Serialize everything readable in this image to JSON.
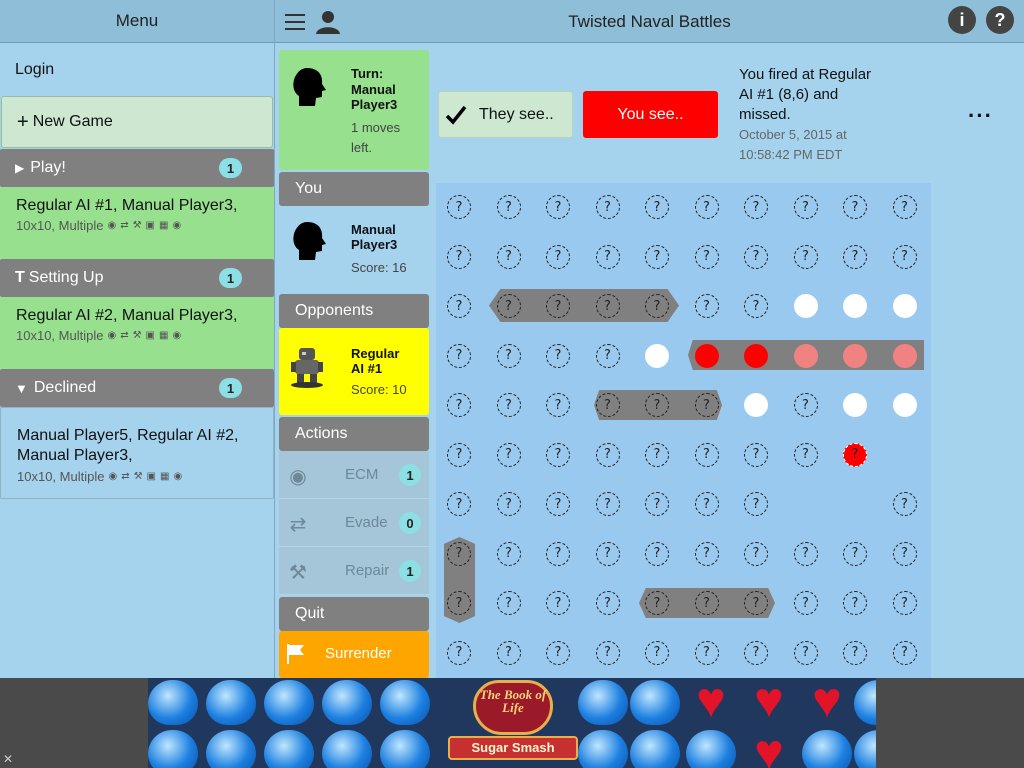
{
  "menu": {
    "title": "Menu",
    "login": "Login",
    "new_game": "New Game",
    "sections": {
      "play": {
        "label": "Play!",
        "count": "1"
      },
      "setting_up": {
        "label": "Setting Up",
        "count": "1"
      },
      "declined": {
        "label": "Declined",
        "count": "1"
      }
    },
    "games": {
      "play": {
        "title": "Regular AI #1, Manual Player3,",
        "sub": "10x10, Multiple"
      },
      "setting_up": {
        "title": "Regular AI #2, Manual Player3,",
        "sub": "10x10, Multiple"
      },
      "declined": {
        "title": "Manual Player5, Regular AI #2, Manual Player3,",
        "sub": "10x10, Multiple"
      }
    }
  },
  "header": {
    "title": "Twisted Naval Battles"
  },
  "turn": {
    "label": "Turn:",
    "player": "Manual Player3",
    "moves": "1 moves left."
  },
  "you": {
    "header": "You",
    "name": "Manual Player3",
    "score": "Score: 16"
  },
  "opponents": {
    "header": "Opponents",
    "name": "Regular AI #1",
    "score": "Score: 10"
  },
  "actions": {
    "header": "Actions",
    "items": [
      {
        "label": "ECM",
        "count": "1",
        "icon": "eye-slash-icon"
      },
      {
        "label": "Evade",
        "count": "0",
        "icon": "shuffle-icon"
      },
      {
        "label": "Repair",
        "count": "1",
        "icon": "wrench-icon"
      }
    ]
  },
  "quit": {
    "header": "Quit",
    "surrender": "Surrender"
  },
  "view": {
    "they_see": "They see..",
    "you_see": "You see.."
  },
  "message": {
    "text": "You fired at Regular AI #1 (8,6) and missed.",
    "date": "October 5, 2015 at 10:58:42 PM EDT"
  },
  "colors": {
    "accent_red": "#ff0000",
    "turn_green": "#96e08e",
    "opponent_yellow": "#ffff00",
    "surrender_orange": "#ffa500"
  },
  "board": {
    "legend": {
      "unknown": "?",
      "miss": "",
      "hit": ""
    },
    "unknown_glyph": "?",
    "rows": [
      "UUUUUUUUUU",
      "UUUUUUUUUU",
      "UUUUUUUMMM",
      "UUUUMHHPPP",
      "UUUUUUMUMM",
      "UUUUUUUUR.",
      "UUUUUUU..U",
      "UUUUUUUUUU",
      "UUUUUUUUUU",
      "UUUUUUUUUU"
    ]
  },
  "ad": {
    "brand": "The Book of Life",
    "game": "Sugar Smash"
  }
}
